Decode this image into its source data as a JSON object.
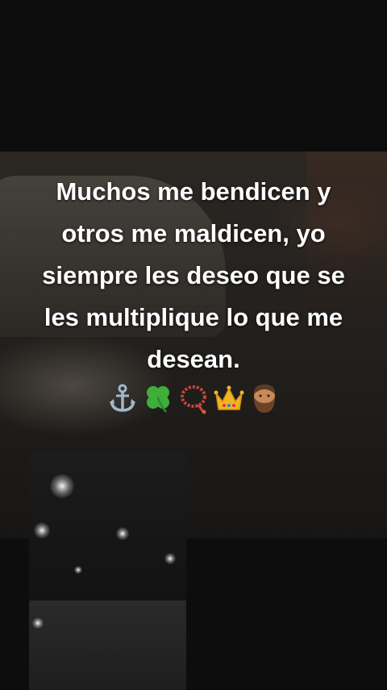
{
  "caption": {
    "lines": [
      "Muchos me bendicen y",
      "otros me maldicen, yo",
      "siempre les deseo que se",
      "les multiplique lo que me",
      "desean."
    ]
  },
  "emojis": [
    "anchor-icon",
    "four-leaf-clover-icon",
    "prayer-beads-icon",
    "crown-icon",
    "bearded-man-icon"
  ]
}
